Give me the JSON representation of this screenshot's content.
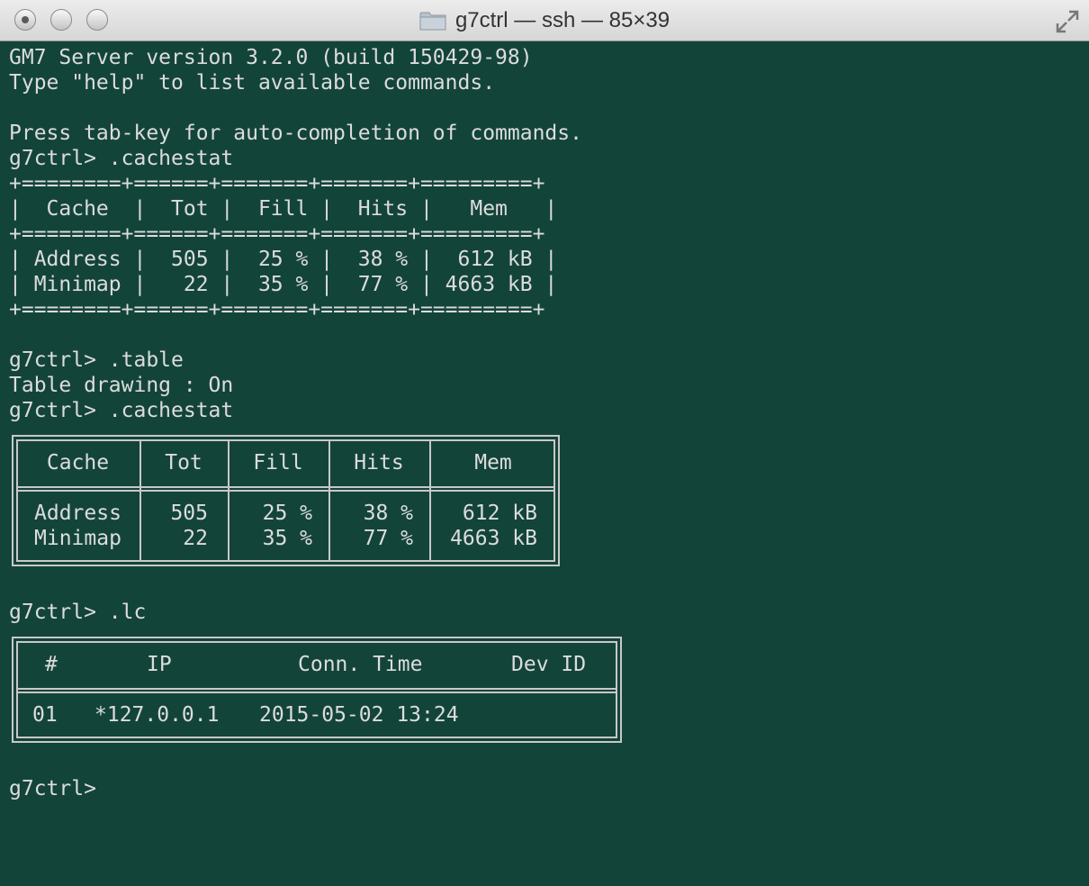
{
  "window": {
    "title": "g7ctrl — ssh — 85×39",
    "colors": {
      "background": "#13443a",
      "text": "#dcdcdc",
      "border": "#c8c8c8"
    },
    "icons": [
      "close-button",
      "minimize-button",
      "zoom-button",
      "folder-icon",
      "fullscreen-icon"
    ]
  },
  "terminal": {
    "lines": {
      "l1": "GM7 Server version 3.2.0 (build 150429-98)",
      "l2": "Type \"help\" to list available commands.",
      "l3": "Press tab-key for auto-completion of commands.",
      "l4": "g7ctrl> .cachestat",
      "ascii1": "+========+======+=======+=======+=========+",
      "ascii2": "|  Cache  |  Tot |  Fill |  Hits |   Mem   |",
      "ascii3": "+========+======+=======+=======+=========+",
      "ascii4": "| Address |  505 |  25 % |  38 % |  612 kB |",
      "ascii5": "| Minimap |   22 |  35 % |  77 % | 4663 kB |",
      "ascii6": "+========+======+=======+=======+=========+",
      "l5": "g7ctrl> .table",
      "l6": "Table drawing : On",
      "l7": "g7ctrl> .cachestat",
      "l8": "g7ctrl> .lc",
      "l9": "g7ctrl>"
    },
    "cache_table": {
      "headers": [
        "Cache",
        "Tot",
        "Fill",
        "Hits",
        "Mem"
      ],
      "rows": [
        [
          "Address",
          "505",
          "25 %",
          "38 %",
          "612 kB"
        ],
        [
          "Minimap",
          "22",
          "35 %",
          "77 %",
          "4663 kB"
        ]
      ]
    },
    "lc_table": {
      "headers": [
        "#",
        "IP",
        "Conn. Time",
        "Dev ID"
      ],
      "rows": [
        [
          "01",
          "*127.0.0.1",
          "2015-05-02 13:24",
          ""
        ]
      ]
    }
  }
}
